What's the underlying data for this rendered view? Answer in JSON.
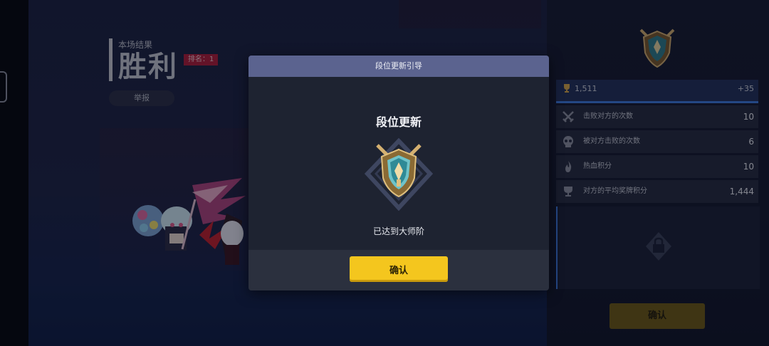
{
  "result": {
    "subtitle": "本场结果",
    "title": "胜利",
    "rank_tag": "排名：1",
    "report_label": "举报"
  },
  "trophy": {
    "value": "1,511",
    "delta": "+35",
    "icon": "trophy-icon"
  },
  "stats": [
    {
      "label": "击败对方的次数",
      "value": "10",
      "icon": "crossed-swords-icon"
    },
    {
      "label": "被对方击败的次数",
      "value": "6",
      "icon": "skull-icon"
    },
    {
      "label": "热血积分",
      "value": "10",
      "icon": "flame-icon"
    },
    {
      "label": "对方的平均奖牌积分",
      "value": "1,444",
      "icon": "trophy-icon"
    }
  ],
  "background_confirm_label": "确认",
  "modal": {
    "header_title": "段位更新引导",
    "heading": "段位更新",
    "message": "已达到大师阶",
    "confirm_label": "确认",
    "emblem_icon": "master-rank-shield-icon"
  },
  "colors": {
    "accent_yellow": "#f4c61e",
    "modal_header": "#5b638f",
    "rank_tag_red": "#b01d3a",
    "progress_blue": "#3d7ae0"
  }
}
